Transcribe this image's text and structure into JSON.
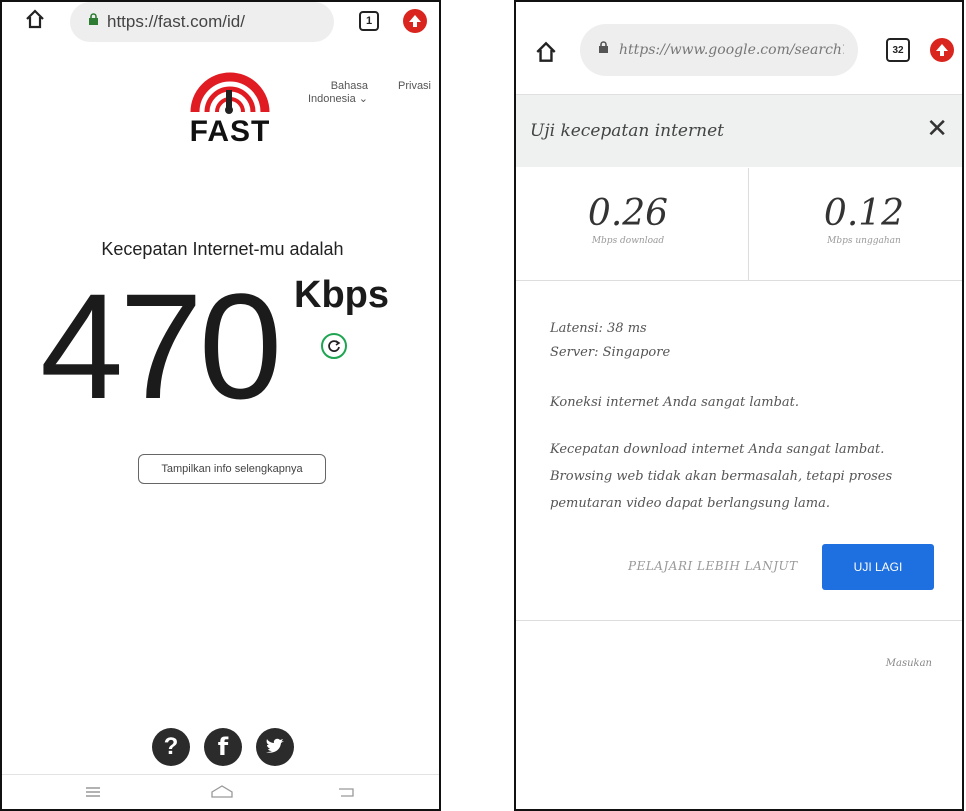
{
  "left_phone": {
    "url": "https://fast.com/id/",
    "tab_count": "1",
    "logo_text": "FAST",
    "language_line1": "Bahasa",
    "language_line2": "Indonesia",
    "privacy": "Privasi",
    "headline": "Kecepatan Internet-mu adalah",
    "speed_value": "470",
    "speed_unit": "Kbps",
    "more_info_button": "Tampilkan info selengkapnya",
    "icons": [
      "home-icon",
      "lock-icon",
      "tabs-icon",
      "opera-icon",
      "refresh-icon",
      "help-icon",
      "facebook-icon",
      "twitter-icon",
      "menu-icon",
      "home-outline-icon",
      "back-icon"
    ],
    "colors": {
      "logo_red": "#e11b22",
      "refresh_green": "#1fa552"
    }
  },
  "right_phone": {
    "url": "https://www.google.com/search?",
    "tab_count": "32",
    "panel_title": "Uji kecepatan internet",
    "download_value": "0.26",
    "download_label": "Mbps download",
    "upload_value": "0.12",
    "upload_label": "Mbps unggahan",
    "latency": "Latensi: 38 ms",
    "server": "Server: Singapore",
    "connection_status": "Koneksi internet Anda sangat lambat.",
    "description": "Kecepatan download internet Anda sangat lambat. Browsing web tidak akan bermasalah, tetapi proses pemutaran video dapat berlangsung lama.",
    "learn_more": "PELAJARI LEBIH LANJUT",
    "retry_button": "UJI LAGI",
    "feedback": "Masukan",
    "colors": {
      "retry_blue": "#1e6fe0"
    }
  }
}
